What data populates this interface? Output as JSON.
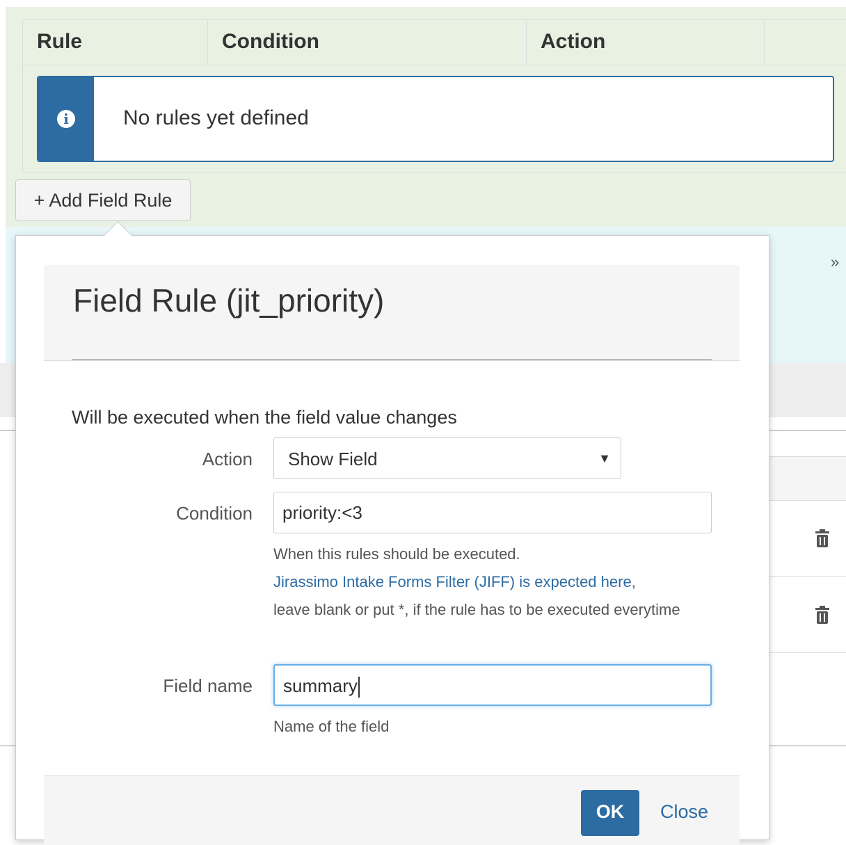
{
  "rules_table": {
    "headers": [
      "Rule",
      "Condition",
      "Action",
      ""
    ],
    "empty_message": "No rules yet defined"
  },
  "add_rule_button": "+ Add Field Rule",
  "dialog": {
    "title": "Field Rule (jit_priority)",
    "description": "Will be executed when the field value changes",
    "action_label": "Action",
    "action_value": "Show Field",
    "condition_label": "Condition",
    "condition_value": "priority:<3",
    "condition_help_line1": "When this rules should be executed.",
    "condition_help_link": "Jirassimo Intake Forms Filter (JIFF) is expected here",
    "condition_help_line3": "leave blank or put *, if the rule has to be executed everytime",
    "field_name_label": "Field name",
    "field_name_value": "summary",
    "field_name_help": "Name of the field",
    "ok_label": "OK",
    "close_label": "Close"
  },
  "icons": {
    "info": "info-circle-icon",
    "collapse": "double-chevron-down-icon",
    "delete": "trash-icon"
  },
  "colors": {
    "accent": "#2d6ca2",
    "section_green": "#e9f1e2",
    "section_blue": "#e6f6f9"
  }
}
